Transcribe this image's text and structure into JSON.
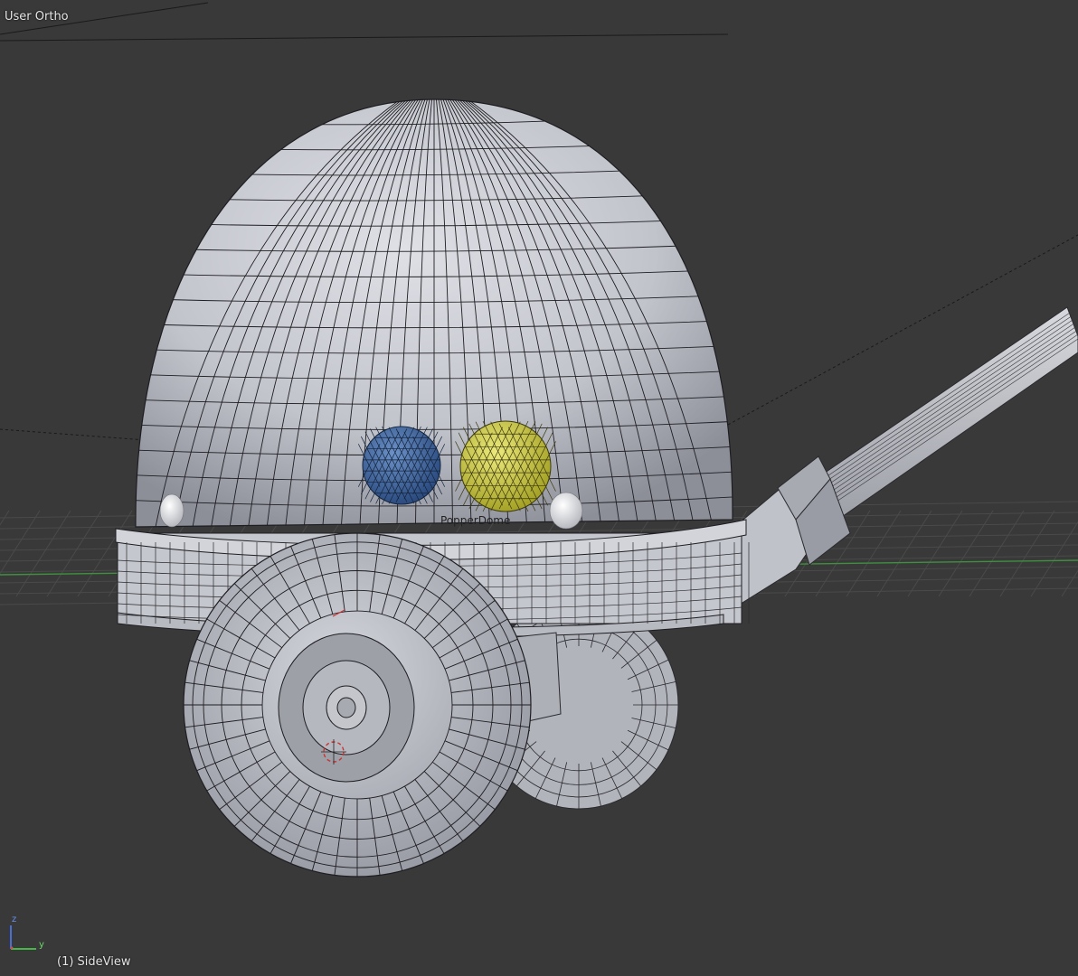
{
  "viewport": {
    "view_label": "User Ortho",
    "object_info": "(1) SideView",
    "active_object_label": "PopperDome",
    "gizmo": {
      "z_label": "z",
      "y_label": "y"
    }
  },
  "colors": {
    "background": "#393939",
    "grid": "#4a4a4a",
    "y_axis_line": "#3f8f3f",
    "mesh_surface": "#c4c6ce",
    "mesh_wire": "#1e1e22",
    "eye_left": "#3f68a4",
    "eye_right": "#c8c53a",
    "cursor": "#cc3333"
  }
}
